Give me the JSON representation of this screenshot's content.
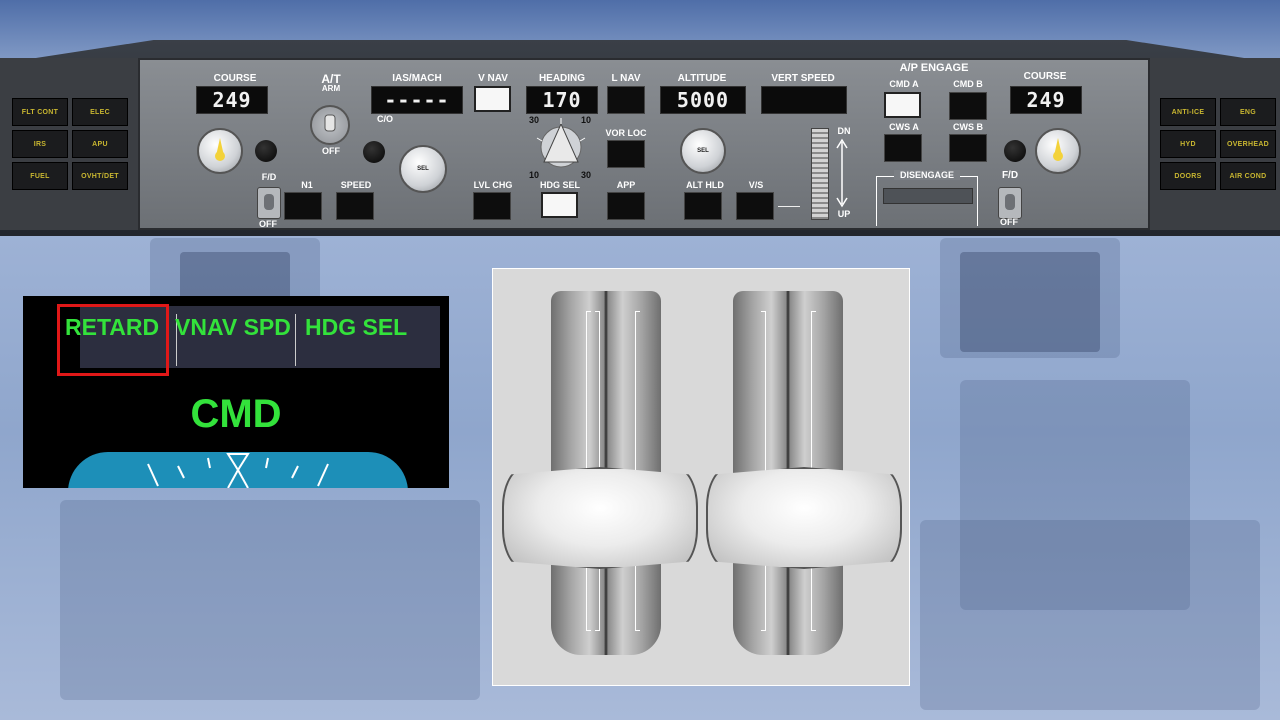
{
  "annunciators_left": [
    "FLT CONT",
    "ELEC",
    "IRS",
    "APU",
    "FUEL",
    "OVHT/DET"
  ],
  "annunciators_right": [
    "ANTI-ICE",
    "ENG",
    "HYD",
    "OVERHEAD",
    "DOORS",
    "AIR COND"
  ],
  "mcp": {
    "course_left": {
      "label": "COURSE",
      "value": "249"
    },
    "course_right": {
      "label": "COURSE",
      "value": "249"
    },
    "fd_left": {
      "label": "F/D",
      "off": "OFF"
    },
    "fd_right": {
      "label": "F/D",
      "off": "OFF"
    },
    "autothrottle": {
      "label": "A/T",
      "sub": "ARM",
      "off": "OFF"
    },
    "ias_mach": {
      "label": "IAS/MACH",
      "value": "-----"
    },
    "co_label": "C/O",
    "n1_label": "N1",
    "speed_label": "SPEED",
    "vnav_label": "V NAV",
    "lvlchg_label": "LVL CHG",
    "heading": {
      "label": "HEADING",
      "value": "170",
      "sel": "HDG SEL",
      "bank_30a": "30",
      "bank_10a": "10",
      "bank_10b": "10",
      "bank_30b": "30"
    },
    "lnav_label": "L NAV",
    "vorloc_label": "VOR LOC",
    "app_label": "APP",
    "altitude": {
      "label": "ALTITUDE",
      "value": "5000"
    },
    "althld_label": "ALT HLD",
    "vs_label": "V/S",
    "vert_speed_label": "VERT SPEED",
    "vs_dn": "DN",
    "vs_up": "UP",
    "ap_engage": {
      "label": "A/P ENGAGE",
      "cmd_a": "CMD A",
      "cmd_b": "CMD B",
      "cws_a": "CWS A",
      "cws_b": "CWS B"
    },
    "disengage_label": "DISENGAGE",
    "sel_knob": "SEL"
  },
  "fma": {
    "col1": "RETARD",
    "col2": "VNAV SPD",
    "col3": "HDG SEL",
    "status": "CMD"
  },
  "colors": {
    "fma_green": "#33e23b",
    "highlight_red": "#e01818",
    "annunciator_amber": "#c8b630"
  }
}
